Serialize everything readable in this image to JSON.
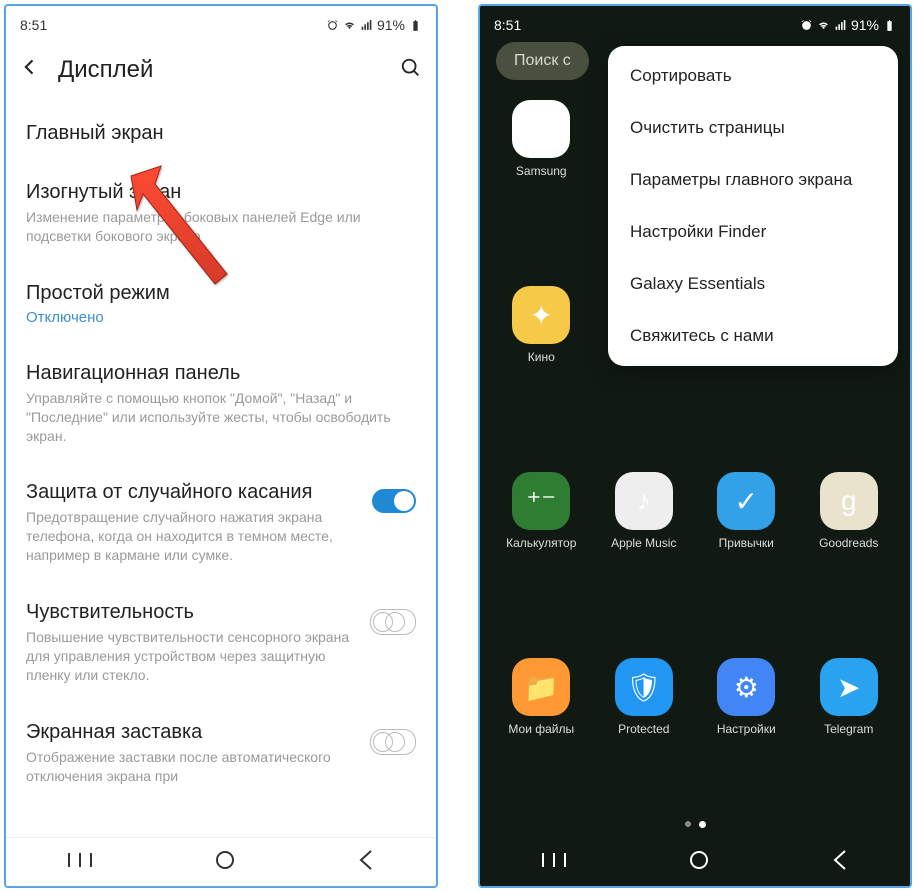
{
  "left": {
    "status": {
      "time": "8:51",
      "battery": "91%"
    },
    "header": {
      "title": "Дисплей"
    },
    "items": [
      {
        "title": "Главный экран",
        "desc": "",
        "status": ""
      },
      {
        "title": "Изогнутый экран",
        "desc": "Изменение параметров боковых панелей Edge или подсветки бокового экрана",
        "status": ""
      },
      {
        "title": "Простой режим",
        "desc": "",
        "status": "Отключено"
      },
      {
        "title": "Навигационная панель",
        "desc": "Управляйте с помощью кнопок \"Домой\", \"Назад\" и \"Последние\" или используйте жесты, чтобы освободить экран.",
        "status": ""
      },
      {
        "title": "Защита от случайного касания",
        "desc": "Предотвращение случайного нажатия экрана телефона, когда он находится в темном месте, например в кармане или сумке.",
        "status": ""
      },
      {
        "title": "Чувствительность",
        "desc": "Повышение чувствительности сенсорного экрана для управления устройством через защитную пленку или стекло.",
        "status": ""
      },
      {
        "title": "Экранная заставка",
        "desc": "Отображение заставки после автоматического отключения экрана при",
        "status": ""
      }
    ]
  },
  "right": {
    "status": {
      "time": "8:51",
      "battery": "91%"
    },
    "search_placeholder": "Поиск с",
    "menu": [
      "Сортировать",
      "Очистить страницы",
      "Параметры главного экрана",
      "Настройки Finder",
      "Galaxy Essentials",
      "Свяжитесь с нами"
    ],
    "apps": [
      {
        "label": "Samsung",
        "icon": "samsung-folder-icon",
        "cls": "ic-samsung",
        "glyph": "▦"
      },
      {
        "label": "",
        "icon": "blank",
        "cls": "",
        "glyph": ""
      },
      {
        "label": "",
        "icon": "blank",
        "cls": "",
        "glyph": ""
      },
      {
        "label": "",
        "icon": "blank",
        "cls": "",
        "glyph": ""
      },
      {
        "label": "Кино",
        "icon": "cinema-icon",
        "cls": "ic-cinema",
        "glyph": "✦"
      },
      {
        "label": "",
        "icon": "blank",
        "cls": "",
        "glyph": ""
      },
      {
        "label": "",
        "icon": "blank",
        "cls": "",
        "glyph": ""
      },
      {
        "label": "",
        "icon": "blank",
        "cls": "",
        "glyph": ""
      },
      {
        "label": "Калькулятор",
        "icon": "calculator-icon",
        "cls": "ic-calc",
        "glyph": "⁺⁻"
      },
      {
        "label": "Apple Music",
        "icon": "apple-music-icon",
        "cls": "ic-apple",
        "glyph": "♪"
      },
      {
        "label": "Привычки",
        "icon": "habits-icon",
        "cls": "ic-habits",
        "glyph": "✓"
      },
      {
        "label": "Goodreads",
        "icon": "goodreads-icon",
        "cls": "ic-goodreads",
        "glyph": "g"
      },
      {
        "label": "Мои файлы",
        "icon": "files-icon",
        "cls": "ic-files",
        "glyph": "📁"
      },
      {
        "label": "Protected",
        "icon": "protected-icon",
        "cls": "ic-protected",
        "glyph": "🛡"
      },
      {
        "label": "Настройки",
        "icon": "settings-icon",
        "cls": "ic-settings",
        "glyph": "⚙"
      },
      {
        "label": "Telegram",
        "icon": "telegram-icon",
        "cls": "ic-telegram",
        "glyph": "➤"
      }
    ]
  }
}
